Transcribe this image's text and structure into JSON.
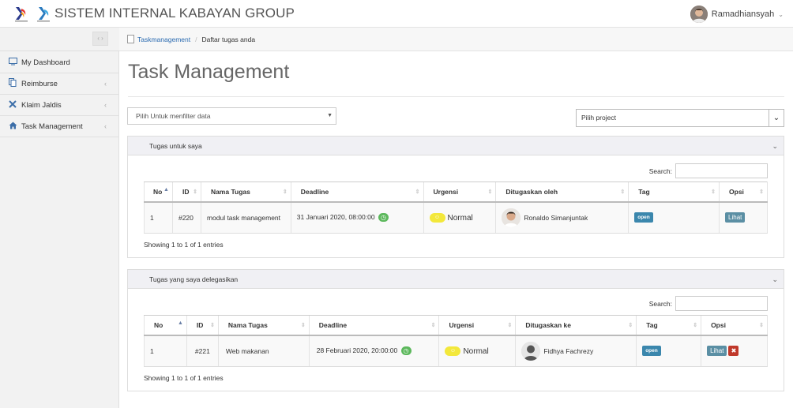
{
  "header": {
    "title": "SISTEM INTERNAL KABAYAN GROUP",
    "user_name": "Ramadhiansyah",
    "caret": "⌄"
  },
  "sidebar": {
    "collapse_label": "‹ ›",
    "items": [
      {
        "label": "My Dashboard",
        "icon": "monitor-icon",
        "has_chevron": false
      },
      {
        "label": "Reimburse",
        "icon": "copy-icon",
        "has_chevron": true
      },
      {
        "label": "Klaim Jaldis",
        "icon": "plane-icon",
        "has_chevron": true
      },
      {
        "label": "Task Management",
        "icon": "home-icon",
        "has_chevron": true
      }
    ]
  },
  "breadcrumb": {
    "link": "Taskmanagement",
    "separator": "/",
    "current": "Daftar tugas anda"
  },
  "page": {
    "title": "Task Management",
    "filter_placeholder": "Pilih Untuk menfilter data",
    "project_placeholder": "Pilih project"
  },
  "panel1": {
    "title": "Tugas untuk saya",
    "search_label": "Search:",
    "columns": [
      "No",
      "ID",
      "Nama Tugas",
      "Deadline",
      "Urgensi",
      "Ditugaskan oleh",
      "Tag",
      "Opsi"
    ],
    "row": {
      "no": "1",
      "id": "#220",
      "name": "modul task management",
      "deadline": "31 Januari 2020, 08:00:00",
      "urgency": "Normal",
      "assigned": "Ronaldo Simanjuntak",
      "tag": "open",
      "action": "Lihat"
    },
    "showing": "Showing 1 to 1 of 1 entries"
  },
  "panel2": {
    "title": "Tugas yang saya delegasikan",
    "search_label": "Search:",
    "columns": [
      "No",
      "ID",
      "Nama Tugas",
      "Deadline",
      "Urgensi",
      "Ditugaskan ke",
      "Tag",
      "Opsi"
    ],
    "row": {
      "no": "1",
      "id": "#221",
      "name": "Web makanan",
      "deadline": "28 Februari 2020, 20:00:00",
      "urgency": "Normal",
      "assigned": "Fidhya Fachrezy",
      "tag": "open",
      "action": "Lihat",
      "delete": "✖"
    },
    "showing": "Showing 1 to 1 of 1 entries"
  },
  "colors": {
    "accent": "#2a6ab0",
    "tag": "#3b87ad",
    "urgency_normal": "#f3e83b",
    "deadline_clock": "#5cb85c",
    "delete": "#c0392b"
  }
}
